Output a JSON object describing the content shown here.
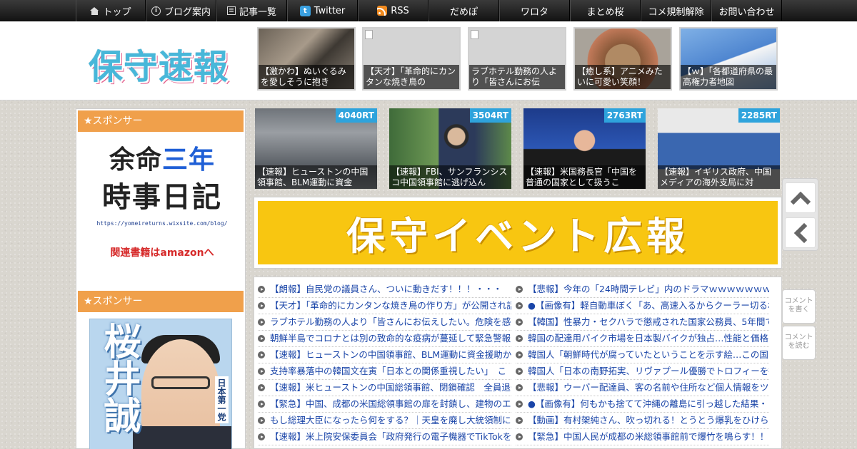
{
  "nav": {
    "items": [
      {
        "label": "トップ",
        "icon": "home-icon"
      },
      {
        "label": "ブログ案内",
        "icon": "info-icon"
      },
      {
        "label": "記事一覧",
        "icon": "list-icon"
      },
      {
        "label": "Twitter",
        "icon": "twitter-icon"
      },
      {
        "label": "RSS",
        "icon": "rss-icon"
      },
      {
        "label": "だめぽ"
      },
      {
        "label": "ワロタ"
      },
      {
        "label": "まとめ桜"
      },
      {
        "label": "コメ規制解除"
      },
      {
        "label": "お問い合わせ"
      }
    ]
  },
  "header": {
    "logo": "保守速報",
    "thumbs": [
      {
        "caption": "【激かわ】ぬいぐるみを愛しそうに抱き"
      },
      {
        "caption": "【天才】「革命的にカンタンな焼き鳥の"
      },
      {
        "caption": "ラブホテル勤務の人より「皆さんにお伝"
      },
      {
        "caption": "【癒し系】アニメみたいに可愛い笑顔！"
      },
      {
        "caption": "【ｗ】「各都道府県の最高権力者地図"
      }
    ]
  },
  "sidebar": {
    "sponsor_label_1": "★スポンサー",
    "ad1": {
      "line1a": "余命",
      "line1b": "三年",
      "line2": "時事日記",
      "url": "https://yomeireturns.wixsite.com/blog/",
      "amazon": "関連書籍はamazonへ"
    },
    "sponsor_label_2": "★スポンサー",
    "ad2": {
      "name": "桜井誠",
      "kana": "さくらい",
      "party": "日本第一党"
    }
  },
  "rt_cards": [
    {
      "count": "4040RT",
      "caption": "【速報】ヒューストンの中国領事館、BLM運動に資金"
    },
    {
      "count": "3504RT",
      "caption": "【速報】FBI、サンフランシスコ中国領事館に逃げ込ん"
    },
    {
      "count": "2763RT",
      "caption": "【速報】米国務長官「中国を普通の国家として扱うこ"
    },
    {
      "count": "2285RT",
      "caption": "【速報】イギリス政府、中国メディアの海外支局に対"
    }
  ],
  "event_banner": "保守イベント広報",
  "articles": {
    "left": [
      "【朗報】自民党の議員さん、ついに動きだす！！！・・・",
      "【天才】「革命的にカンタンな焼き鳥の作り方」が公開され話",
      "ラブホテル勤務の人より「皆さんにお伝えしたい。危険を感じ",
      "朝鮮半島でコロナとは別の致命的な疫病が蔓延して緊急警報が",
      "【速報】ヒューストンの中国領事館、BLM運動に資金援助か",
      "支持率暴落中の韓国文在寅「日本との関係重視したい」　こ",
      "【速報】米ヒューストンの中国総領事館、閉鎖確認　全員退去",
      "【緊急】中国、成都の米国総領事館の扉を封鎖し、建物のエン",
      "もし総理大臣になったら何をする？｜天皇を廃し大統領制に",
      "【速報】米上院安保委員会「政府発行の電子機器でTikTokをダ"
    ],
    "right": [
      "【悲報】今年の「24時間テレビ」内のドラマｗｗｗｗｗｗｗｗ",
      "●【画像有】軽自動車ぼく「あ、高速入るからクーラー切るね",
      "【韓国】性暴力・セクハラで懲戒された国家公務員、5年間で1",
      "韓国の配達用バイク市場を日本製バイクが独占…性能と価格で",
      "韓国人「朝鮮時代が腐っていたということを示す絵…この国は",
      "韓国人「日本の南野拓実、リヴァプール優勝でトロフィーを掲",
      "【悲報】ウーバー配達員、客の名前や住所など個人情報をツイ",
      "●【画像有】何もかも捨てて沖縄の離島に引っ越した結果・・",
      "【動画】有村架純さん、吹っ切れる！とうとう爆乳をひけらか",
      "【緊急】中国人民が成都の米総領事館前で爆竹を鳴らす！！"
    ]
  },
  "side_buttons": {
    "comment_write": "コメントを書く",
    "comment_read": "コメントを読む"
  }
}
